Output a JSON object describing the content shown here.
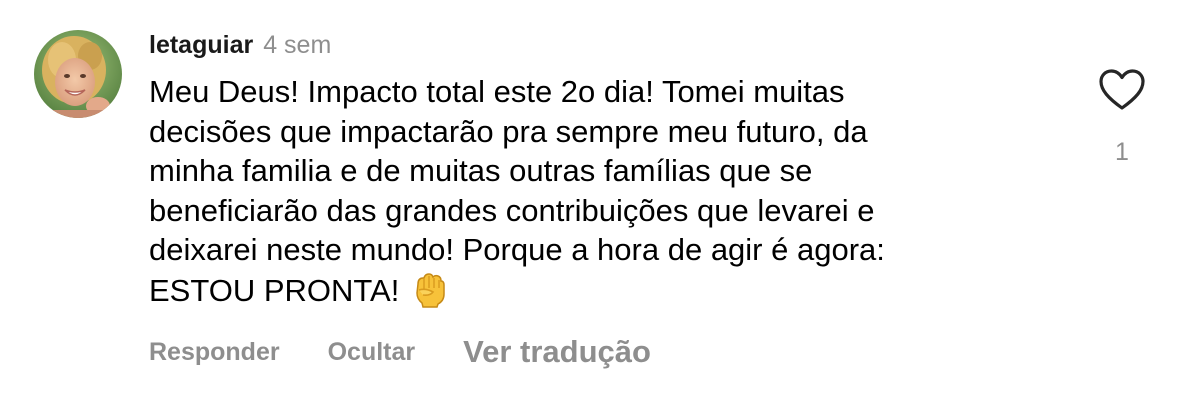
{
  "comment": {
    "username": "letaguiar",
    "timestamp": "4 sem",
    "text_lines": [
      "Meu Deus! Impacto total este 2o dia! Tomei muitas",
      "decisões que impactarão pra sempre meu futuro, da",
      "minha familia e de muitas outras famílias que se",
      "beneficiarão das grandes contribuições que levarei e",
      "deixarei neste mundo! Porque a hora de agir é agora:",
      "ESTOU PRONTA!"
    ],
    "emoji": "raised-fist",
    "like_count": "1",
    "actions": {
      "reply": "Responder",
      "hide": "Ocultar",
      "translate": "Ver tradução"
    }
  },
  "colors": {
    "secondary_text": "#8e8e8e",
    "primary_text": "#000000",
    "icon_stroke": "#262626"
  }
}
